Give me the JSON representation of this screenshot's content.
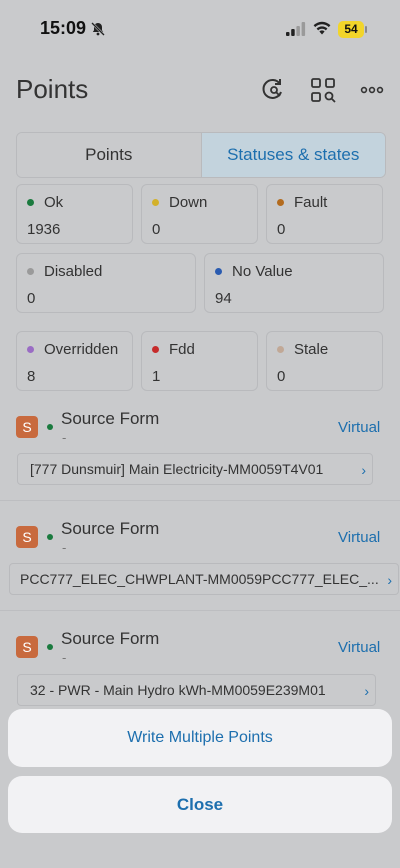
{
  "status_bar": {
    "time": "15:09",
    "battery": "54"
  },
  "header": {
    "title": "Points"
  },
  "tabs": [
    {
      "label": "Points"
    },
    {
      "label": "Statuses & states"
    }
  ],
  "statuses": [
    {
      "label": "Ok",
      "value": "1936",
      "color": "#1a7a3e"
    },
    {
      "label": "Down",
      "value": "0",
      "color": "#d3b12a"
    },
    {
      "label": "Fault",
      "value": "0",
      "color": "#b36b1e"
    },
    {
      "label": "Disabled",
      "value": "0",
      "color": "#9a9a9a"
    },
    {
      "label": "No Value",
      "value": "94",
      "color": "#2a5bb0"
    },
    {
      "label": "Overridden",
      "value": "8",
      "color": "#9a6cc4"
    },
    {
      "label": "Fdd",
      "value": "1",
      "color": "#c62b2b"
    },
    {
      "label": "Stale",
      "value": "0",
      "color": "#c1a896"
    }
  ],
  "sources": [
    {
      "icon_letter": "S",
      "title": "Source Form",
      "subtitle": "-",
      "tag": "Virtual",
      "point": "[777 Dunsmuir] Main Electricity-MM0059T4V01"
    },
    {
      "icon_letter": "S",
      "title": "Source Form",
      "subtitle": "-",
      "tag": "Virtual",
      "point": "PCC777_ELEC_CHWPLANT-MM0059PCC777_ELEC_..."
    },
    {
      "icon_letter": "S",
      "title": "Source Form",
      "subtitle": "-",
      "tag": "Virtual",
      "point": "32 - PWR -  Main Hydro kWh-MM0059E239M01"
    }
  ],
  "action_sheet": {
    "write_multiple_label": "Write Multiple Points",
    "close_label": "Close"
  }
}
